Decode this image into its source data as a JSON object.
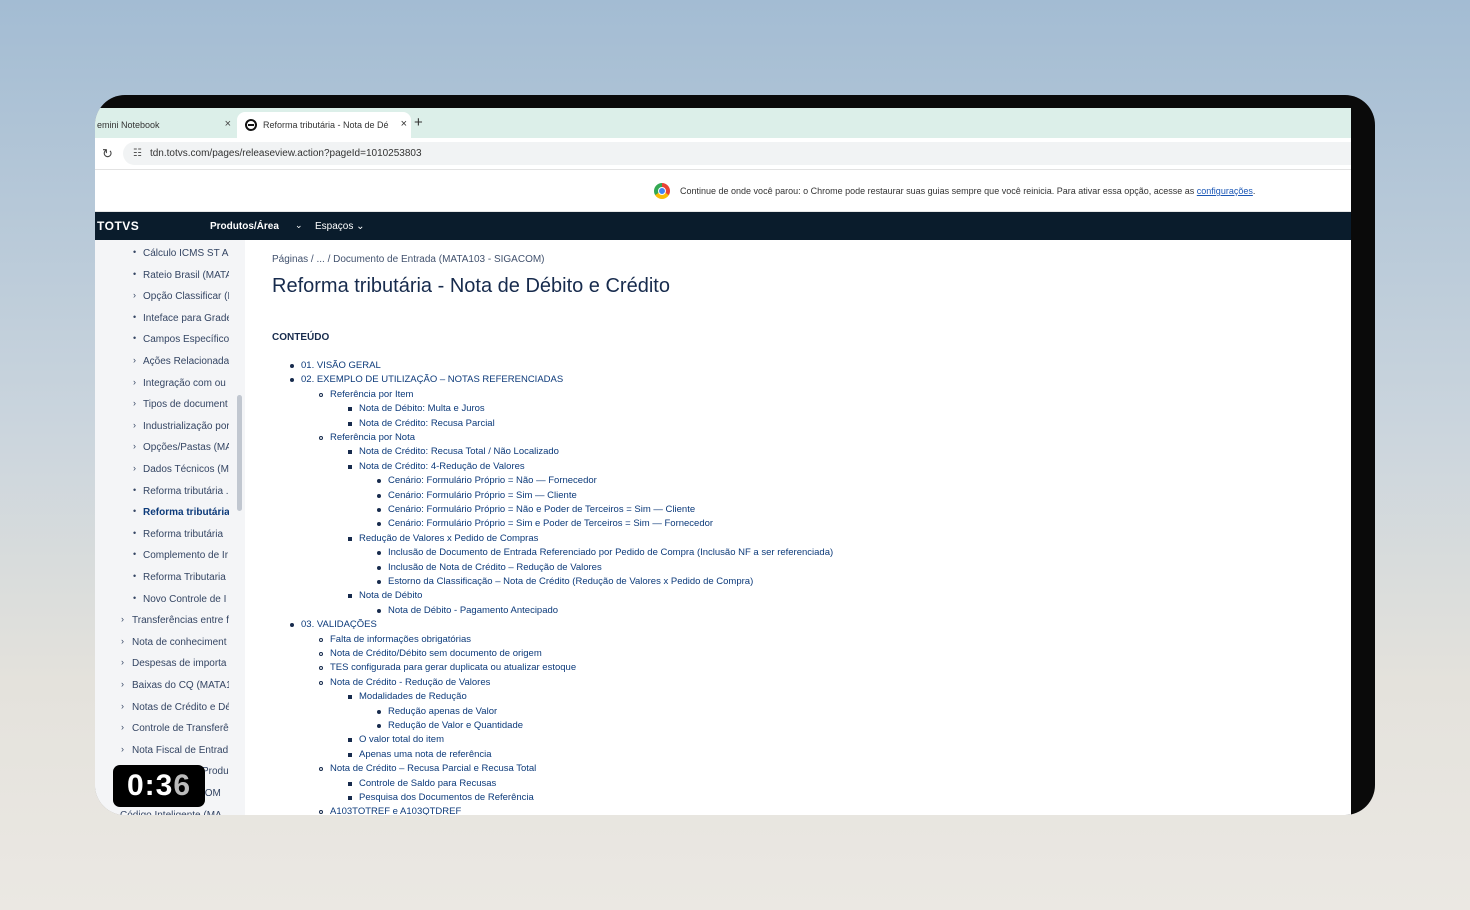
{
  "browser": {
    "tabs": [
      {
        "label": "emini Notebook",
        "close": "×"
      },
      {
        "label": "Reforma tributária - Nota de Dé",
        "close": "×"
      }
    ],
    "new_tab": "+",
    "url": "tdn.totvs.com/pages/releaseview.action?pageId=1010253803",
    "infobar": {
      "text": "Continue de onde você parou: o Chrome pode restaurar suas guias sempre que você reinicia. Para ativar essa opção, acesse as ",
      "link": "configurações",
      "suffix": "."
    }
  },
  "nav": {
    "logo": "TOTVS",
    "items": [
      {
        "label": "Produtos/Área"
      },
      {
        "label": "Espaços"
      }
    ],
    "chevron": "⌄"
  },
  "sidebar": {
    "items": [
      {
        "label": "Cálculo ICMS ST Ar",
        "marker": "•"
      },
      {
        "label": "Rateio Brasil (MATA",
        "marker": "•"
      },
      {
        "label": "Opção Classificar (N",
        "marker": "›"
      },
      {
        "label": "Inteface para Grade",
        "marker": "•"
      },
      {
        "label": "Campos Específicos",
        "marker": "•"
      },
      {
        "label": "Ações Relacionadas",
        "marker": "›"
      },
      {
        "label": "Integração com ou",
        "marker": "›"
      },
      {
        "label": "Tipos de document",
        "marker": "›"
      },
      {
        "label": "Industrialização por",
        "marker": "›"
      },
      {
        "label": "Opções/Pastas (MA",
        "marker": "›"
      },
      {
        "label": "Dados Técnicos (M.",
        "marker": "›"
      },
      {
        "label": "Reforma tributária .",
        "marker": "•"
      },
      {
        "label": "Reforma tributária",
        "marker": "•",
        "active": true
      },
      {
        "label": "Reforma tributária",
        "marker": "•"
      },
      {
        "label": "Complemento de Ir",
        "marker": "•"
      },
      {
        "label": "Reforma Tributaria",
        "marker": "•"
      },
      {
        "label": "Novo Controle de I",
        "marker": "•"
      },
      {
        "label": "Transferências entre f",
        "marker": "›"
      },
      {
        "label": "Nota de conheciment",
        "marker": "›"
      },
      {
        "label": "Despesas de importa",
        "marker": "›"
      },
      {
        "label": "Baixas do CQ (MATA1",
        "marker": "›"
      },
      {
        "label": "Notas de Crédito e Dé",
        "marker": "›"
      },
      {
        "label": "Controle de Transferê",
        "marker": "›"
      },
      {
        "label": "Nota Fiscal de Entrad",
        "marker": "›"
      },
      {
        "label": "Produ",
        "marker": "›"
      },
      {
        "label": "IOM",
        "marker": "›"
      },
      {
        "label": "Código Inteligente (MA",
        "marker": "›"
      }
    ]
  },
  "content": {
    "breadcrumb": "Páginas  /  ...  /  Documento de Entrada (MATA103 - SIGACOM)",
    "title": "Reforma tributária - Nota de Débito e Crédito",
    "toc_heading": "CONTEÚDO",
    "toc": [
      {
        "text": "01. VISÃO GERAL",
        "level": 1
      },
      {
        "text": "02. EXEMPLO DE UTILIZAÇÃO – NOTAS REFERENCIADAS",
        "level": 1
      },
      {
        "text": "Referência por Item",
        "level": 2
      },
      {
        "text": "Nota de Débito: Multa e Juros",
        "level": 3
      },
      {
        "text": "Nota de Crédito: Recusa Parcial",
        "level": 3
      },
      {
        "text": "Referência por Nota",
        "level": 2
      },
      {
        "text": "Nota de Crédito: Recusa Total / Não Localizado",
        "level": 3
      },
      {
        "text": "Nota de Crédito: 4-Redução de Valores",
        "level": 3
      },
      {
        "text": "Cenário: Formulário Próprio = Não — Fornecedor",
        "level": 4
      },
      {
        "text": "Cenário: Formulário Próprio = Sim — Cliente",
        "level": 4
      },
      {
        "text": "Cenário: Formulário Próprio = Não e Poder de Terceiros = Sim — Cliente",
        "level": 4
      },
      {
        "text": "Cenário: Formulário Próprio = Sim e Poder de Terceiros = Sim — Fornecedor",
        "level": 4
      },
      {
        "text": "Redução de Valores x Pedido de Compras",
        "level": 3
      },
      {
        "text": "Inclusão de Documento de Entrada Referenciado por Pedido de Compra (Inclusão NF a ser referenciada)",
        "level": 4
      },
      {
        "text": "Inclusão de Nota de Crédito – Redução de Valores",
        "level": 4
      },
      {
        "text": "Estorno da Classificação – Nota de Crédito (Redução de Valores x Pedido de Compra)",
        "level": 4
      },
      {
        "text": "Nota de Débito",
        "level": 3
      },
      {
        "text": "Nota de Débito - Pagamento Antecipado",
        "level": 4
      },
      {
        "text": "03. VALIDAÇÕES",
        "level": 1
      },
      {
        "text": "Falta de informações obrigatórias",
        "level": 2
      },
      {
        "text": "Nota de Crédito/Débito sem documento de origem",
        "level": 2
      },
      {
        "text": "TES configurada para gerar duplicata ou atualizar estoque",
        "level": 2
      },
      {
        "text": "Nota de Crédito - Redução de Valores",
        "level": 2
      },
      {
        "text": "Modalidades de Redução",
        "level": 3
      },
      {
        "text": "Redução apenas de Valor",
        "level": 4
      },
      {
        "text": "Redução de Valor e Quantidade",
        "level": 4
      },
      {
        "text": "O valor total do item",
        "level": 3
      },
      {
        "text": "Apenas uma nota de referência",
        "level": 3
      },
      {
        "text": "Nota de Crédito – Recusa Parcial e Recusa Total",
        "level": 2
      },
      {
        "text": "Controle de Saldo para Recusas",
        "level": 3
      },
      {
        "text": "Pesquisa dos Documentos de Referência",
        "level": 3
      },
      {
        "text": "A103TOTREF e A103QTDREF",
        "level": 2
      }
    ]
  },
  "timer": {
    "main": "0:3",
    "last": "6"
  },
  "colors": {
    "nav_bg": "#0a1c2c",
    "link": "#0c3a7a",
    "tabstrip": "#dcefe9",
    "sidebar_bg": "#f4f5f7"
  }
}
